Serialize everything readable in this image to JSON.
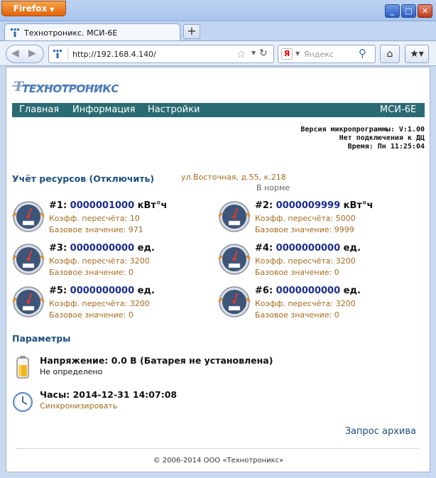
{
  "browser": {
    "app_button": "Firefox",
    "tab_title": "Технотроникс. МСИ-6Е",
    "url": "http://192.168.4.140/",
    "search_placeholder": "Яндекс",
    "search_engine_letter": "Я"
  },
  "site": {
    "logo_text": "ТЕХНОТРОНИКС",
    "menu": [
      {
        "label": "Главная"
      },
      {
        "label": "Информация"
      },
      {
        "label": "Настройки"
      }
    ],
    "device_name": "МСИ-6Е"
  },
  "sysinfo": {
    "firmware": "Версия микропрограммы: V:1.00",
    "connection": "Нет подключения к ДЦ",
    "time": "Время: Пн 11:25:04"
  },
  "resources": {
    "title": "Учёт ресурсов (Отключить)",
    "address": "ул.Восточная, д.55, к.218",
    "status": "В норме",
    "meters": [
      {
        "label": "#1:",
        "value": "0000001000",
        "unit": "кВт°ч",
        "coef": "Коэфф. пересчёта: 10",
        "base": "Базовое значение: 971"
      },
      {
        "label": "#2:",
        "value": "0000009999",
        "unit": "кВт°ч",
        "coef": "Коэфф. пересчёта: 5000",
        "base": "Базовое значение: 9999"
      },
      {
        "label": "#3:",
        "value": "0000000000",
        "unit": "ед.",
        "coef": "Коэфф. пересчёта: 3200",
        "base": "Базовое значение: 0"
      },
      {
        "label": "#4:",
        "value": "0000000000",
        "unit": "ед.",
        "coef": "Коэфф. пересчёта: 3200",
        "base": "Базовое значение: 0"
      },
      {
        "label": "#5:",
        "value": "0000000000",
        "unit": "ед.",
        "coef": "Коэфф. пересчёта: 3200",
        "base": "Базовое значение: 0"
      },
      {
        "label": "#6:",
        "value": "0000000000",
        "unit": "ед.",
        "coef": "Коэфф. пересчёта: 3200",
        "base": "Базовое значение: 0"
      }
    ]
  },
  "parameters": {
    "title": "Параметры",
    "voltage": "Напряжение: 0.0 В (Батарея не установлена)",
    "voltage_state": "Не определено",
    "clock": "Часы: 2014-12-31 14:07:08",
    "sync": "Синхронизировать"
  },
  "archive_link": "Запрос архива",
  "footer": "© 2006-2014 ООО «Технотроникс»",
  "colors": {
    "menu_bg": "#2a6b73",
    "link_blue": "#1d4f7e",
    "meter_value": "#1c2d8f",
    "secondary_text": "#a66b1e"
  }
}
